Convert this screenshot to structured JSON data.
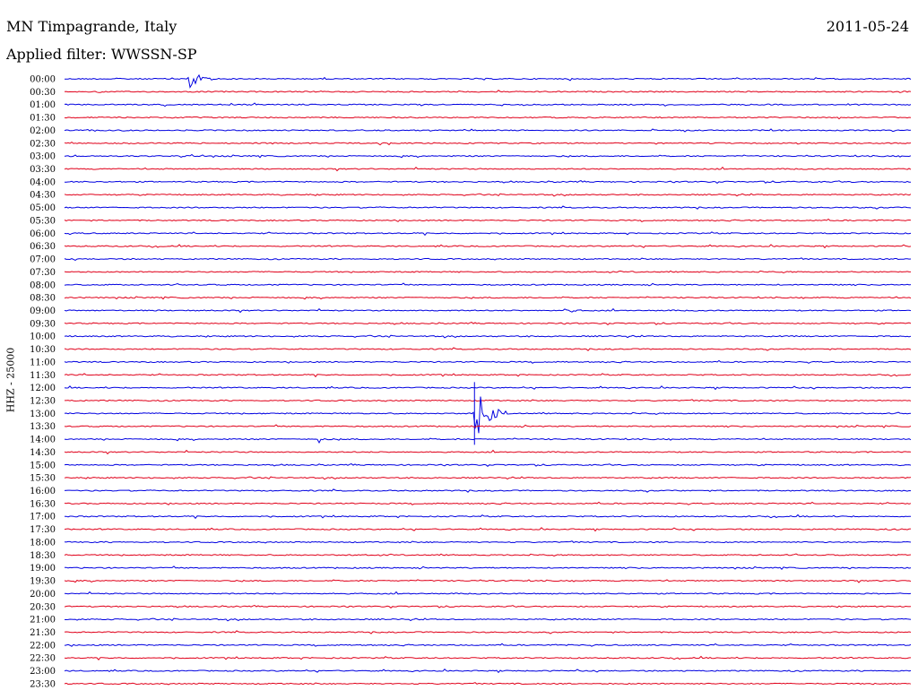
{
  "header": {
    "station": "MN Timpagrande, Italy",
    "date": "2011-05-24",
    "filter": "Applied filter: WWSSN-SP"
  },
  "chart_data": {
    "type": "line",
    "ylabel": "HHZ - 25000",
    "colors": [
      "#0000e0",
      "#e0001a"
    ],
    "grid": false,
    "trace_labels": [
      "00:00",
      "00:30",
      "01:00",
      "01:30",
      "02:00",
      "02:30",
      "03:00",
      "03:30",
      "04:00",
      "04:30",
      "05:00",
      "05:30",
      "06:00",
      "06:30",
      "07:00",
      "07:30",
      "08:00",
      "08:30",
      "09:00",
      "09:30",
      "10:00",
      "10:30",
      "11:00",
      "11:30",
      "12:00",
      "12:30",
      "13:00",
      "13:30",
      "14:00",
      "14:30",
      "15:00",
      "15:30",
      "16:00",
      "16:30",
      "17:00",
      "17:30",
      "18:00",
      "18:30",
      "19:00",
      "19:30",
      "20:00",
      "20:30",
      "21:00",
      "21:30",
      "22:00",
      "22:30",
      "23:00",
      "23:30"
    ],
    "events": [
      {
        "trace": "00:00",
        "minute": 4.4,
        "amplitude": 12,
        "duration": 1.2
      },
      {
        "trace": "09:00",
        "minute": 17.7,
        "amplitude": 4,
        "duration": 0.8
      },
      {
        "trace": "13:00",
        "minute": 14.5,
        "amplitude": 35,
        "duration": 1.2
      },
      {
        "trace": "14:00",
        "minute": 9.0,
        "amplitude": 5,
        "duration": 0.3
      }
    ]
  }
}
